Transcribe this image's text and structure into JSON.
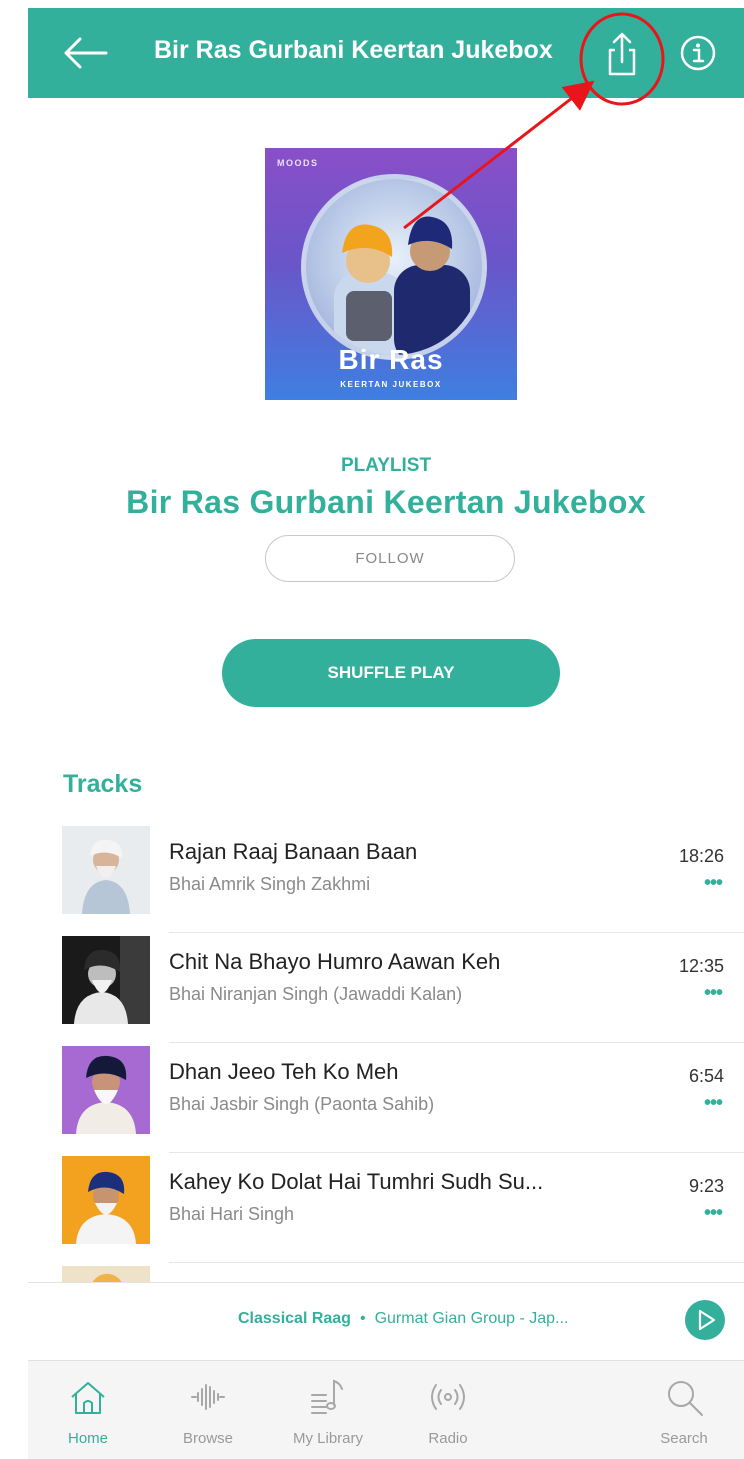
{
  "header": {
    "title": "Bir Ras Gurbani Keertan Jukebox",
    "back_icon": "arrow-left-icon",
    "share_icon": "share-icon",
    "info_icon": "info-icon"
  },
  "cover": {
    "brand": "MOODS",
    "title": "Bir Ras",
    "subtitle": "KEERTAN JUKEBOX"
  },
  "playlist": {
    "label": "PLAYLIST",
    "title": "Bir Ras Gurbani Keertan Jukebox",
    "follow_label": "FOLLOW",
    "shuffle_label": "SHUFFLE PLAY"
  },
  "tracks": {
    "heading": "Tracks",
    "items": [
      {
        "name": "Rajan Raaj Banaan Baan",
        "artist": "Bhai Amrik Singh Zakhmi",
        "duration": "18:26",
        "more": "•••"
      },
      {
        "name": "Chit Na Bhayo Humro Aawan Keh",
        "artist": "Bhai Niranjan Singh (Jawaddi Kalan)",
        "duration": "12:35",
        "more": "•••"
      },
      {
        "name": "Dhan Jeeo Teh Ko Meh",
        "artist": "Bhai Jasbir Singh (Paonta Sahib)",
        "duration": "6:54",
        "more": "•••"
      },
      {
        "name": "Kahey Ko Dolat Hai Tumhri Sudh Su...",
        "artist": "Bhai Hari Singh",
        "duration": "9:23",
        "more": "•••"
      }
    ]
  },
  "now_playing": {
    "song": "Classical Raag",
    "separator": "•",
    "artist": "Gurmat Gian Group - Jap..."
  },
  "nav": {
    "items": [
      {
        "label": "Home",
        "icon": "home-icon"
      },
      {
        "label": "Browse",
        "icon": "waveform-icon"
      },
      {
        "label": "My Library",
        "icon": "library-icon"
      },
      {
        "label": "Radio",
        "icon": "radio-icon"
      },
      {
        "label": "Search",
        "icon": "search-icon"
      }
    ]
  },
  "colors": {
    "accent": "#33b09b",
    "annotation": "#e8161b"
  }
}
